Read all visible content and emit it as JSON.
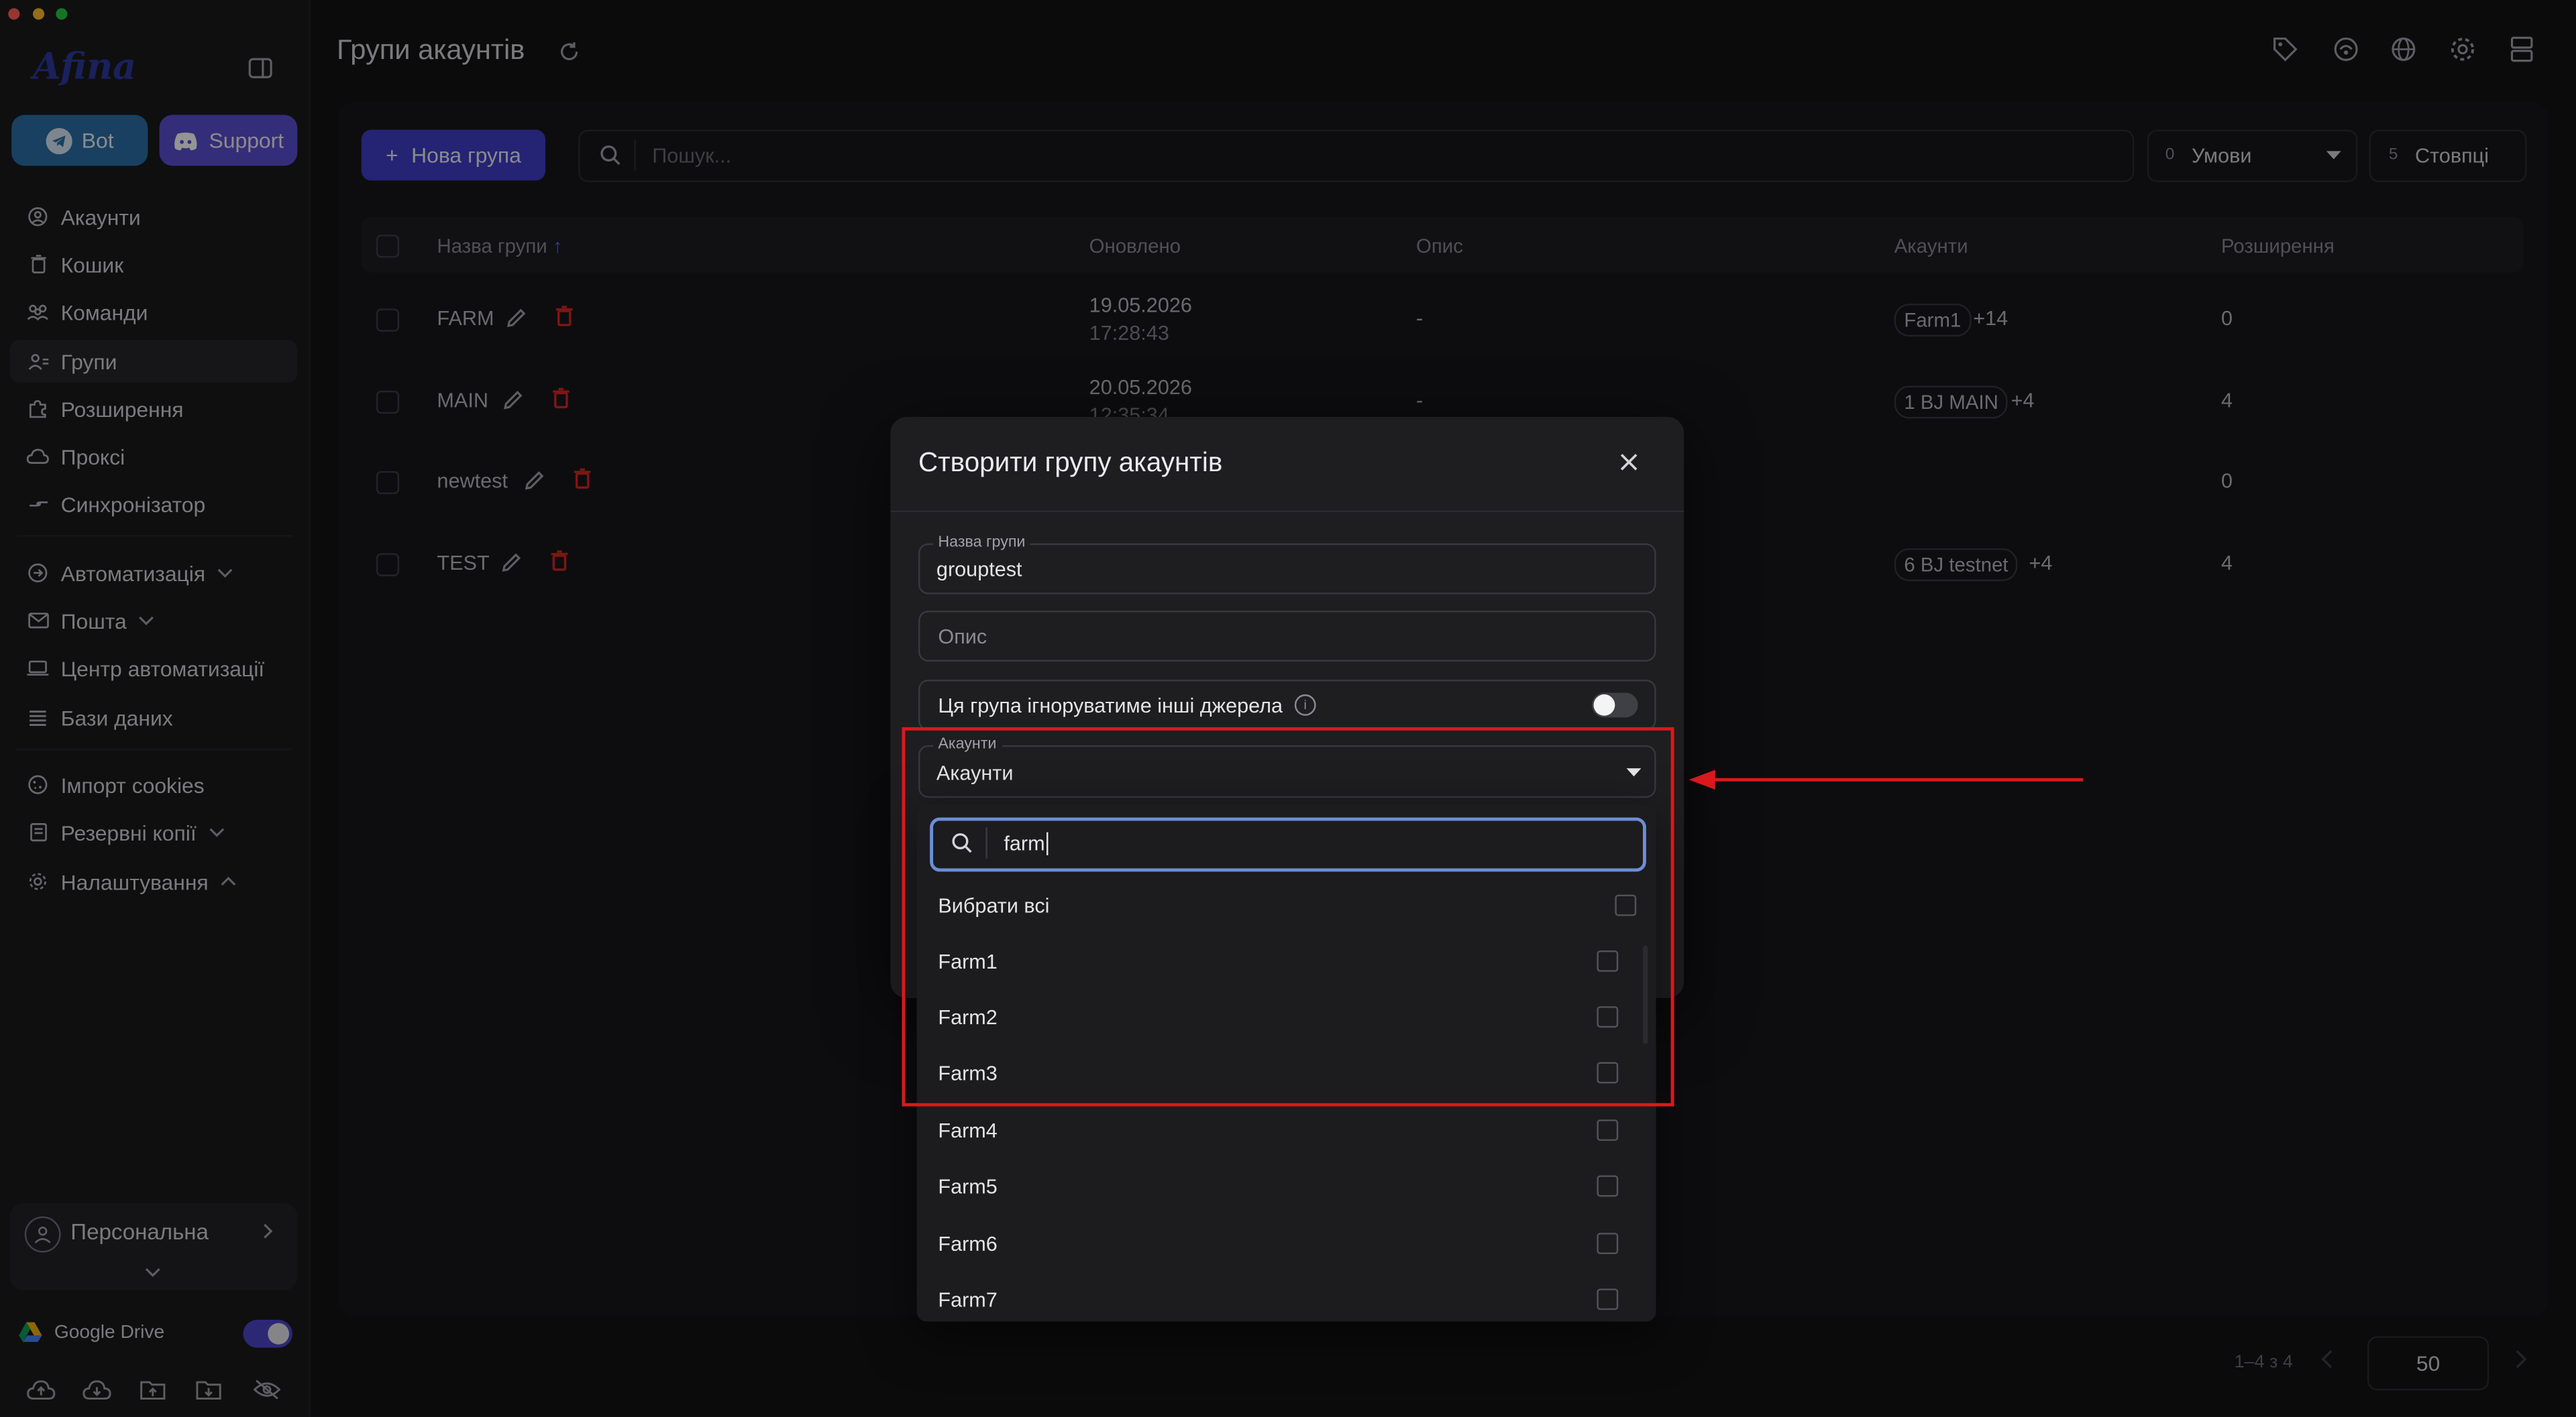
{
  "window": {
    "traffic_lights": [
      "#ff5f57",
      "#febc2e",
      "#28c840"
    ]
  },
  "sidebar": {
    "logo": "Afina",
    "bot_label": "Bot",
    "support_label": "Support",
    "items": [
      {
        "label": "Акаунти",
        "icon": "user-circle-icon"
      },
      {
        "label": "Кошик",
        "icon": "trash-icon"
      },
      {
        "label": "Команди",
        "icon": "team-icon"
      },
      {
        "label": "Групи",
        "icon": "group-icon",
        "active": true
      },
      {
        "label": "Розширення",
        "icon": "puzzle-icon"
      },
      {
        "label": "Проксі",
        "icon": "cloud-icon"
      },
      {
        "label": "Синхронізатор",
        "icon": "sync-icon"
      },
      {
        "label": "Автоматизація",
        "icon": "automation-icon",
        "expandable": true
      },
      {
        "label": "Пошта",
        "icon": "mail-icon",
        "expandable": true
      },
      {
        "label": "Центр автоматизації",
        "icon": "laptop-icon"
      },
      {
        "label": "Бази даних",
        "icon": "list-icon"
      },
      {
        "label": "Імпорт cookies",
        "icon": "cookie-icon"
      },
      {
        "label": "Резервні копії",
        "icon": "backup-icon",
        "expandable": true
      },
      {
        "label": "Налаштування",
        "icon": "gear-icon",
        "expanded": true
      }
    ],
    "workspace": "Персональна",
    "google_drive_label": "Google Drive"
  },
  "header": {
    "title": "Групи акаунтів"
  },
  "toolbar": {
    "new_group_label": "Нова група",
    "search_placeholder": "Пошук...",
    "conditions_count": "0",
    "conditions_label": "Умови",
    "columns_count": "5",
    "columns_label": "Стовпці"
  },
  "table": {
    "columns": [
      "Назва групи",
      "Оновлено",
      "Опис",
      "Акаунти",
      "Розширення"
    ],
    "rows": [
      {
        "name": "FARM",
        "date": "19.05.2026",
        "time": "17:28:43",
        "desc": "-",
        "account": "Farm1",
        "more": "+14",
        "ext": "0"
      },
      {
        "name": "MAIN",
        "date": "20.05.2026",
        "time": "12:35:34",
        "desc": "-",
        "account": "1 BJ MAIN",
        "more": "+4",
        "ext": "4"
      },
      {
        "name": "newtest",
        "date": "",
        "time": "",
        "desc": "",
        "account": "",
        "more": "",
        "ext": "0"
      },
      {
        "name": "TEST",
        "date": "",
        "time": "",
        "desc": "",
        "account": "6 BJ testnet",
        "more": "+4",
        "ext": "4"
      }
    ]
  },
  "pagination": {
    "range": "1–4 з 4",
    "per_page": "50"
  },
  "modal": {
    "title": "Створити групу акаунтів",
    "name_label": "Назва групи",
    "name_value": "grouptest",
    "desc_placeholder": "Опис",
    "ignore_label": "Ця група ігноруватиме інші джерела",
    "accounts_label": "Акаунти",
    "accounts_value": "Акаунти"
  },
  "dropdown": {
    "search_value": "farm",
    "select_all": "Вибрати всі",
    "options": [
      "Farm1",
      "Farm2",
      "Farm3",
      "Farm4",
      "Farm5",
      "Farm6",
      "Farm7"
    ]
  },
  "colors": {
    "accent": "#3f3dc9",
    "highlight": "#d9191b",
    "danger": "#e02424",
    "bot": "#2c6ea8",
    "support": "#5b4fd0"
  }
}
